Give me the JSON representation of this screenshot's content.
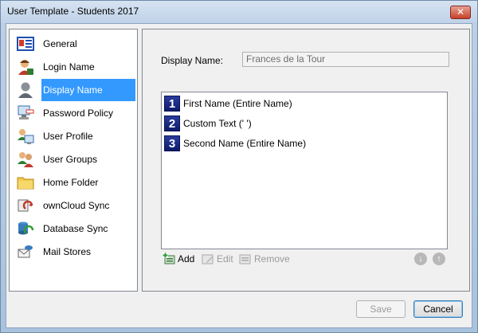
{
  "window": {
    "title": "User Template - Students 2017",
    "close_glyph": "✕"
  },
  "nav": {
    "items": [
      {
        "label": "General",
        "icon": "general-icon"
      },
      {
        "label": "Login Name",
        "icon": "login-name-icon"
      },
      {
        "label": "Display Name",
        "icon": "display-name-icon",
        "selected": true
      },
      {
        "label": "Password Policy",
        "icon": "password-policy-icon"
      },
      {
        "label": "User Profile",
        "icon": "user-profile-icon"
      },
      {
        "label": "User Groups",
        "icon": "user-groups-icon"
      },
      {
        "label": "Home Folder",
        "icon": "home-folder-icon"
      },
      {
        "label": "ownCloud Sync",
        "icon": "owncloud-sync-icon"
      },
      {
        "label": "Database Sync",
        "icon": "database-sync-icon"
      },
      {
        "label": "Mail Stores",
        "icon": "mail-stores-icon"
      }
    ]
  },
  "display_name": {
    "label": "Display Name:",
    "value": "Frances de la Tour",
    "parts": [
      {
        "num": "1",
        "text": "First Name (Entire Name)"
      },
      {
        "num": "2",
        "text": "Custom Text (' ')"
      },
      {
        "num": "3",
        "text": "Second Name (Entire Name)"
      }
    ]
  },
  "toolbar": {
    "add_label": "Add",
    "edit_label": "Edit",
    "remove_label": "Remove",
    "down_glyph": "↓",
    "up_glyph": "↑"
  },
  "footer": {
    "save_label": "Save",
    "cancel_label": "Cancel"
  },
  "colors": {
    "selection": "#3399ff",
    "badge": "#1a2a8a"
  }
}
